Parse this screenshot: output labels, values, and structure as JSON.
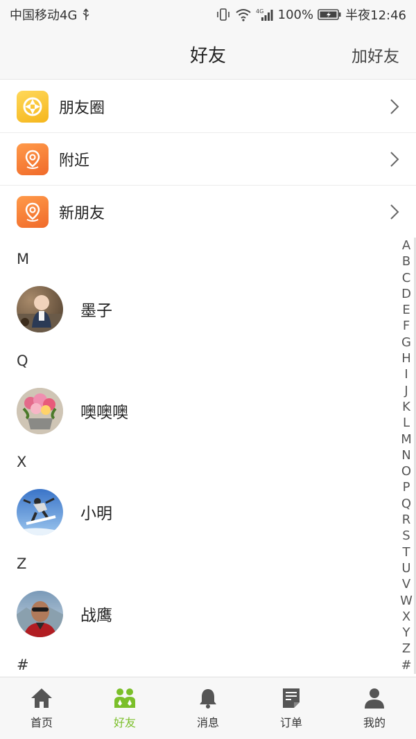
{
  "status_bar": {
    "carrier": "中国移动4G",
    "battery": "100%",
    "time": "半夜12:46",
    "network_label": "4G"
  },
  "header": {
    "title": "好友",
    "add_friend": "加好友"
  },
  "features": [
    {
      "label": "朋友圈",
      "icon": "moments-icon",
      "color": "#f5b61c"
    },
    {
      "label": "附近",
      "icon": "location-pin-icon",
      "color": "#f06a2a"
    },
    {
      "label": "新朋友",
      "icon": "location-pin-icon",
      "color": "#f06a2a"
    }
  ],
  "sections": [
    {
      "letter": "M",
      "friends": [
        {
          "name": "墨子",
          "avatar": "baby-photo"
        }
      ]
    },
    {
      "letter": "Q",
      "friends": [
        {
          "name": "噢噢噢",
          "avatar": "flower-photo"
        }
      ]
    },
    {
      "letter": "X",
      "friends": [
        {
          "name": "小明",
          "avatar": "snowboard-photo"
        }
      ]
    },
    {
      "letter": "Z",
      "friends": [
        {
          "name": "战鹰",
          "avatar": "man-sunglasses-photo"
        }
      ]
    },
    {
      "letter": "#",
      "friends": []
    }
  ],
  "index_letters": [
    "A",
    "B",
    "C",
    "D",
    "E",
    "F",
    "G",
    "H",
    "I",
    "J",
    "K",
    "L",
    "M",
    "N",
    "O",
    "P",
    "Q",
    "R",
    "S",
    "T",
    "U",
    "V",
    "W",
    "X",
    "Y",
    "Z",
    "#"
  ],
  "tabs": [
    {
      "label": "首页",
      "icon": "home-icon",
      "active": false
    },
    {
      "label": "好友",
      "icon": "friends-icon",
      "active": true
    },
    {
      "label": "消息",
      "icon": "bell-icon",
      "active": false
    },
    {
      "label": "订单",
      "icon": "order-icon",
      "active": false
    },
    {
      "label": "我的",
      "icon": "person-icon",
      "active": false
    }
  ],
  "colors": {
    "accent": "#7bbf2a",
    "header_bg": "#f7f7f7"
  }
}
